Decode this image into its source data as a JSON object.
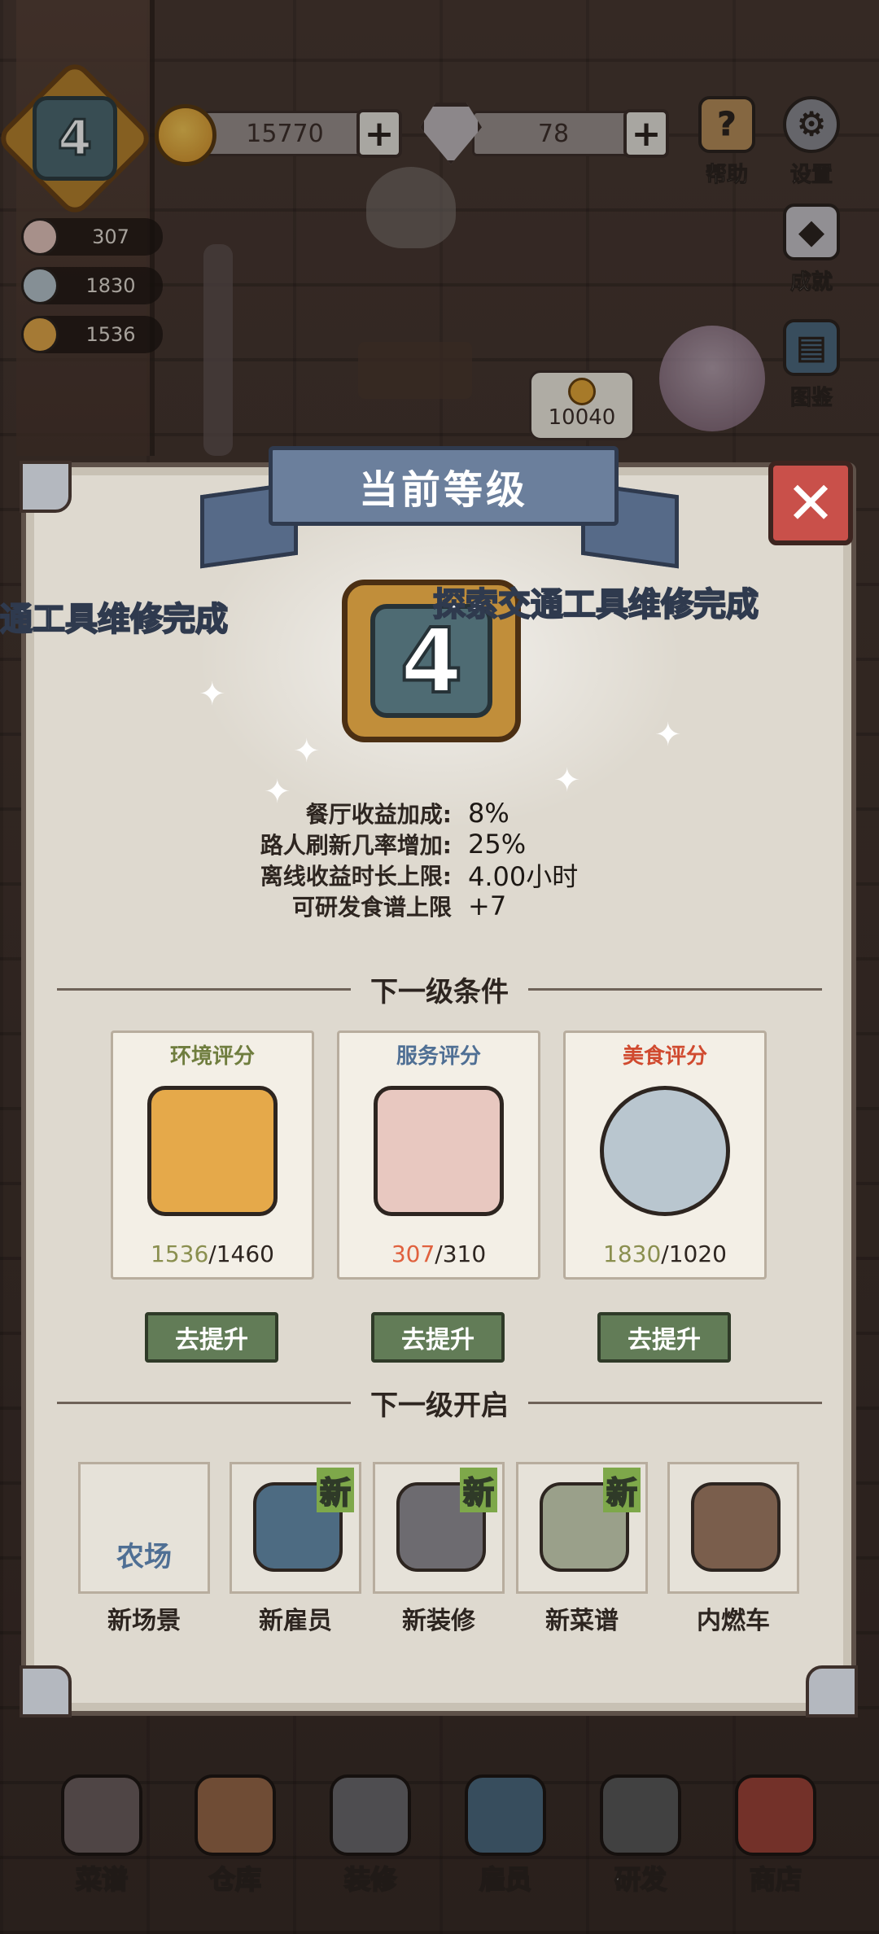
{
  "hud": {
    "level": "4",
    "coins": "15770",
    "gems": "78",
    "plus": "+",
    "help_label": "帮助",
    "settings_label": "设置",
    "achievements_label": "成就",
    "guide_label": "图鉴",
    "service_stat": "307",
    "food_stat": "1830",
    "environment_stat": "1536",
    "bubble_coins": "10040"
  },
  "modal": {
    "title": "当前等级",
    "close": "✕",
    "level": "4",
    "notice_left": "通工具维修完成",
    "notice_right": "探索交通工具维修完成",
    "bonuses": [
      {
        "label": "餐厅收益加成:",
        "value": "8%"
      },
      {
        "label": "路人刷新几率增加:",
        "value": "25%"
      },
      {
        "label": "离线收益时长上限:",
        "value": "4.00小时"
      },
      {
        "label": "可研发食谱上限",
        "value": "+7"
      }
    ],
    "next_conditions_title": "下一级条件",
    "conditions": [
      {
        "title": "环境评分",
        "title_color": "#6f7d3e",
        "current": "1536",
        "required": "/1460",
        "art_color": "#e5a94a"
      },
      {
        "title": "服务评分",
        "title_color": "#4f6f94",
        "current": "307",
        "required": "/310",
        "art_color": "#e8c8c0"
      },
      {
        "title": "美食评分",
        "title_color": "#d04a2f",
        "current": "1830",
        "required": "/1020",
        "art_color": "#b9c6cf"
      }
    ],
    "go_button": "去提升",
    "next_unlock_title": "下一级开启",
    "unlocks": [
      {
        "label": "新场景",
        "art_text": "农场",
        "is_new": false,
        "art_color": "#e6e2d9"
      },
      {
        "label": "新雇员",
        "is_new": true,
        "art_color": "#4d6b82"
      },
      {
        "label": "新装修",
        "is_new": true,
        "art_color": "#6d6b70"
      },
      {
        "label": "新菜谱",
        "is_new": true,
        "art_color": "#9aa08a"
      },
      {
        "label": "内燃车",
        "is_new": false,
        "art_color": "#7a5e4c"
      }
    ],
    "new_tag": "新"
  },
  "nav": {
    "items": [
      {
        "label": "菜谱",
        "color": "#6e6060"
      },
      {
        "label": "仓库",
        "color": "#9a6a4a"
      },
      {
        "label": "装修",
        "color": "#6d6b70"
      },
      {
        "label": "雇员",
        "color": "#4d6b82"
      },
      {
        "label": "研发",
        "color": "#5a5a5a"
      },
      {
        "label": "商店",
        "color": "#a0453a"
      }
    ]
  }
}
